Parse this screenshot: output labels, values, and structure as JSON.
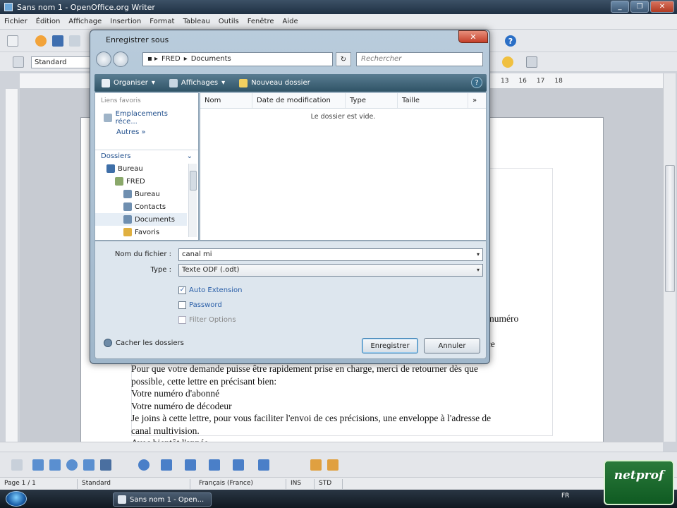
{
  "window": {
    "title": "Sans nom 1 - OpenOffice.org Writer",
    "min": "_",
    "max": "❐",
    "close": "✕"
  },
  "menu": [
    "Fichier",
    "Édition",
    "Affichage",
    "Insertion",
    "Format",
    "Tableau",
    "Outils",
    "Fenêtre",
    "Aide"
  ],
  "toolbar": {
    "style_value": "Standard",
    "help": "?"
  },
  "ruler": {
    "labels": [
      "13",
      "16",
      "17",
      "18"
    ]
  },
  "document": {
    "frag_right_1": "numéro",
    "frag_right_2": "r ce",
    "lines": [
      "Pour que votre demande puisse être rapidement prise en charge, merci de retourner dès que",
      "possible, cette lettre en précisant bien:",
      "Votre numéro d'abonné",
      "Votre numéro de décodeur",
      "Je joins à cette lettre, pour vous faciliter l'envoi de ces précisions, une enveloppe à l'adresse de",
      "canal multivision.",
      "Avec bientôt l'année"
    ]
  },
  "status": {
    "page": "Page 1 / 1",
    "style": "Standard",
    "lang": "Français (France)",
    "ins": "INS",
    "std": "STD"
  },
  "taskbar": {
    "item": "Sans nom 1 - Open...",
    "tray": "FR"
  },
  "logo": {
    "text": "netprof"
  },
  "dialog": {
    "title": "Enregistrer sous",
    "close": "✕",
    "address": [
      "FRED",
      "Documents"
    ],
    "search_placeholder": "Rechercher",
    "toolbar": {
      "organize": "Organiser",
      "view": "Affichages",
      "new_folder": "Nouveau dossier",
      "help": "?"
    },
    "nav": {
      "favorites_header": "Liens favoris",
      "favorites": [
        "Emplacements réce...",
        "Autres »"
      ],
      "folders_header": "Dossiers",
      "tree": [
        "Bureau",
        "FRED",
        "Bureau",
        "Contacts",
        "Documents",
        "Favoris"
      ]
    },
    "columns": [
      "Nom",
      "Date de modification",
      "Type",
      "Taille"
    ],
    "empty_message": "Le dossier est vide.",
    "filename_label": "Nom du fichier :",
    "filename_value": "canal mi",
    "type_label": "Type :",
    "type_value": "Texte ODF (.odt)",
    "options": [
      {
        "label": "Auto Extension",
        "checked": true
      },
      {
        "label": "Password",
        "checked": false
      },
      {
        "label": "Filter Options",
        "checked": false
      }
    ],
    "hide_folders": "Cacher les dossiers",
    "save": "Enregistrer",
    "cancel": "Annuler"
  }
}
